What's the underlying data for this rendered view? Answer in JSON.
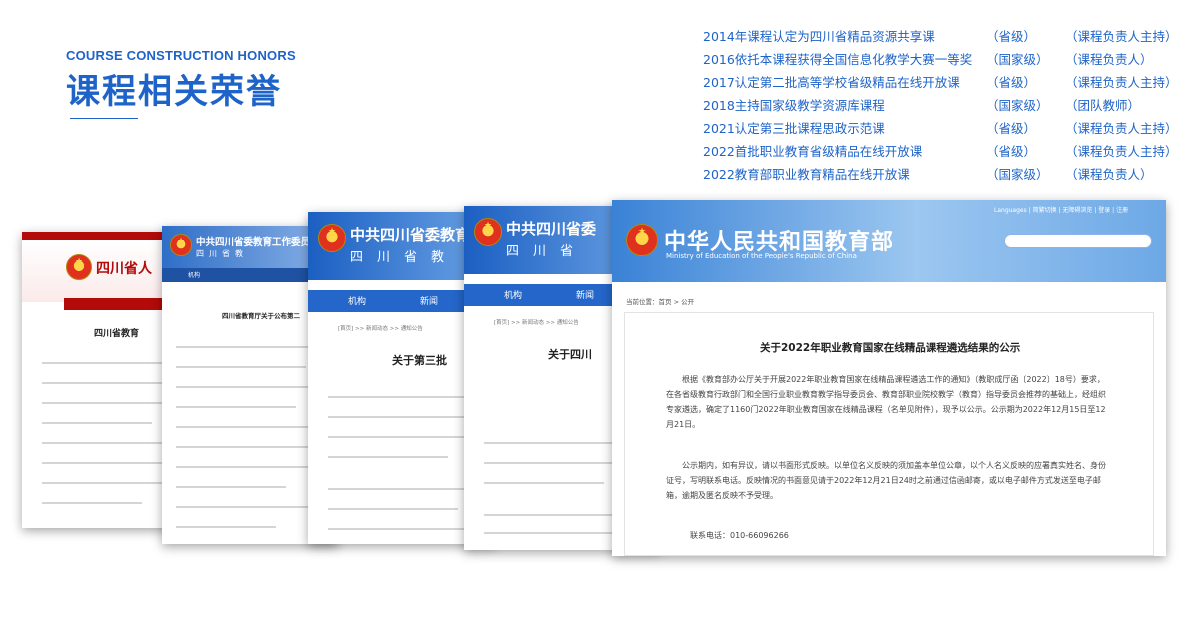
{
  "header": {
    "en_title": "COURSE CONSTRUCTION HONORS",
    "zh_title": "课程相关荣誉"
  },
  "honors": [
    {
      "text": "2014年课程认定为四川省精品资源共享课",
      "level": "（省级）",
      "role": "（课程负责人主持）"
    },
    {
      "text": "2016依托本课程获得全国信息化教学大赛一等奖",
      "level": "（国家级）",
      "role": "（课程负责人）"
    },
    {
      "text": "2017认定第二批高等学校省级精品在线开放课",
      "level": "（省级）",
      "role": "（课程负责人主持）"
    },
    {
      "text": "2018主持国家级教学资源库课程",
      "level": "（国家级）",
      "role": "（团队教师）"
    },
    {
      "text": "2021认定第三批课程思政示范课",
      "level": "（省级）",
      "role": "（课程负责人主持）"
    },
    {
      "text": "2022首批职业教育省级精品在线开放课",
      "level": "（省级）",
      "role": "（课程负责人主持）"
    },
    {
      "text": "2022教育部职业教育精品在线开放课",
      "level": "（国家级）",
      "role": "（课程负责人）"
    }
  ],
  "cards": {
    "c1": {
      "site_name": "四川省人",
      "doc_title": "四川省教育"
    },
    "c2": {
      "site_name": "中共四川省委教育工作委员会",
      "site_sub": "四川省教",
      "nav_label": "机构",
      "doc_title": "四川省教育厅关于公布第二"
    },
    "c3": {
      "site_name": "中共四川省委教育工",
      "site_sub": "四川省教",
      "nav_a": "机构",
      "nav_b": "新闻",
      "bread": "[首页] >> 新闻动态 >> 通知公告",
      "doc_title": "关于第三批"
    },
    "c4": {
      "site_name": "中共四川省委",
      "site_sub": "四川省",
      "nav_a": "机构",
      "nav_b": "新闻",
      "bread": "[首页] >> 新闻动态 >> 通知公告",
      "doc_title": "关于四川"
    },
    "c5": {
      "site_name": "中华人民共和国教育部",
      "site_en": "Ministry of Education of the People's Republic of China",
      "toplinks": "Languages | 简繁切换 | 无障碍浏览 | 登录 | 注册",
      "bread": "当前位置：首页 > 公开",
      "doc_title": "关于2022年职业教育国家在线精品课程遴选结果的公示",
      "para1": "根据《教育部办公厅关于开展2022年职业教育国家在线精品课程遴选工作的通知》（教职成厅函〔2022〕18号）要求，在各省级教育行政部门和全国行业职业教育教学指导委员会、教育部职业院校教学（教育）指导委员会推荐的基础上，经组织专家遴选，确定了1160门2022年职业教育国家在线精品课程（名单见附件），现予以公示。公示期为2022年12月15日至12月21日。",
      "para2": "公示期内，如有异议，请以书面形式反映。以单位名义反映的须加盖本单位公章，以个人名义反映的应署真实姓名、身份证号，写明联系电话。反映情况的书面意见请于2022年12月21日24时之前通过信函邮寄，或以电子邮件方式发送至电子邮箱，逾期及匿名反映不予受理。",
      "contact": "联系电话：010-66096266"
    }
  },
  "colors": {
    "accent": "#1e63c8",
    "red": "#b30a0a"
  }
}
